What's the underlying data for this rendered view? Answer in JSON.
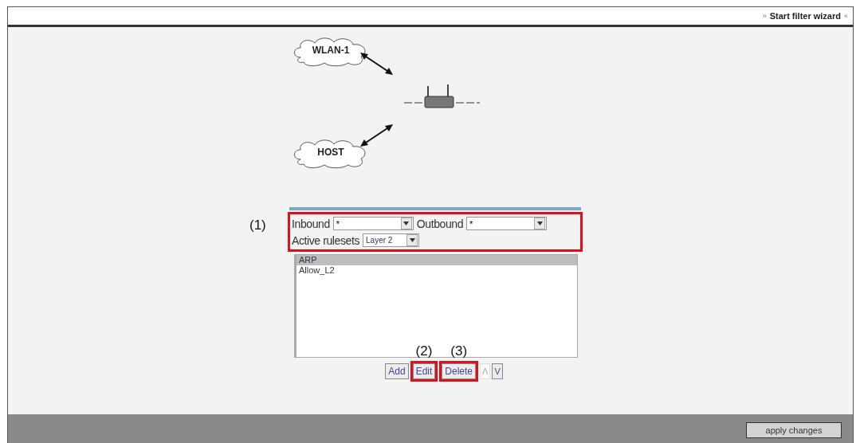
{
  "header": {
    "link": "Start filter wizard",
    "left_mark": "»",
    "right_mark": "«"
  },
  "diagram": {
    "nodes": [
      {
        "kind": "cloud",
        "label": "WLAN-1"
      },
      {
        "kind": "router"
      },
      {
        "kind": "cloud",
        "label": "HOST"
      }
    ]
  },
  "filter": {
    "callout": "(1)",
    "highlighted": true,
    "inbound": {
      "label": "Inbound",
      "value": "*"
    },
    "outbound": {
      "label": "Outbound",
      "value": "*"
    },
    "rulesets": {
      "label": "Active rulesets",
      "value": "Layer 2"
    }
  },
  "rules": [
    {
      "name": "ARP",
      "selected": true
    },
    {
      "name": "Allow_L2",
      "selected": false
    }
  ],
  "buttons": [
    {
      "label": "Add",
      "kind": "text",
      "highlighted": false,
      "disabled": false
    },
    {
      "label": "Edit",
      "kind": "text",
      "highlighted": true,
      "callout": "(2)",
      "disabled": false
    },
    {
      "label": "Delete",
      "kind": "text",
      "highlighted": true,
      "callout": "(3)",
      "disabled": false
    },
    {
      "label": "Λ",
      "kind": "arrow",
      "highlighted": false,
      "disabled": true
    },
    {
      "label": "V",
      "kind": "arrow",
      "highlighted": false,
      "disabled": false
    }
  ],
  "footer": {
    "apply": "apply changes"
  }
}
